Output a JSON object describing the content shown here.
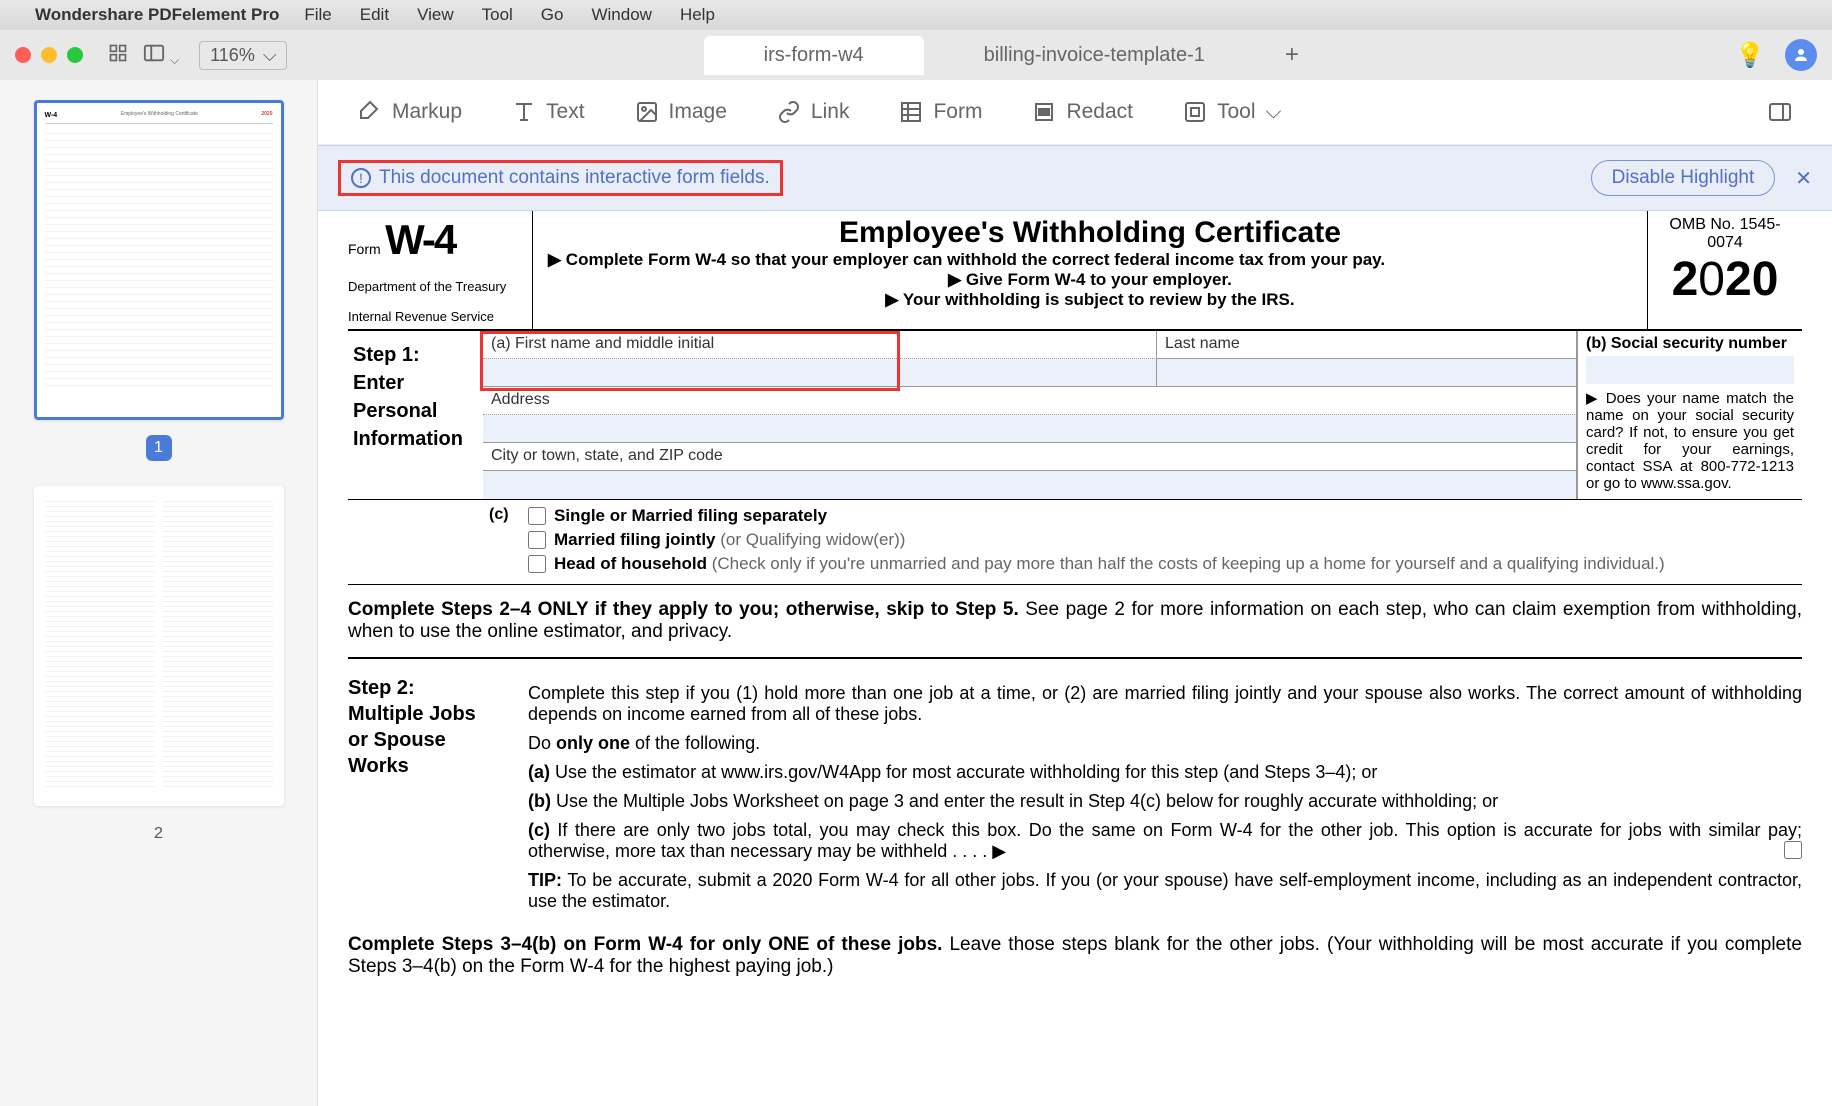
{
  "menubar": {
    "app": "Wondershare PDFelement Pro",
    "items": [
      "File",
      "Edit",
      "View",
      "Tool",
      "Go",
      "Window",
      "Help"
    ]
  },
  "titlebar": {
    "zoom": "116%",
    "tabs": [
      {
        "label": "irs-form-w4",
        "active": true
      },
      {
        "label": "billing-invoice-template-1",
        "active": false
      }
    ]
  },
  "toolbar": {
    "markup": "Markup",
    "text": "Text",
    "image": "Image",
    "link": "Link",
    "form": "Form",
    "redact": "Redact",
    "tool": "Tool"
  },
  "infobar": {
    "message": "This document contains interactive form fields.",
    "disable": "Disable Highlight"
  },
  "thumbnails": {
    "page1": "1",
    "page2": "2"
  },
  "form": {
    "form_prefix": "Form",
    "form_code": "W-4",
    "dept1": "Department of the Treasury",
    "dept2": "Internal Revenue Service",
    "title": "Employee's Withholding Certificate",
    "bullet1": "▶ Complete Form W-4 so that your employer can withhold the correct federal income tax from your pay.",
    "bullet2": "▶ Give Form W-4 to your employer.",
    "bullet3": "▶ Your withholding is subject to review by the IRS.",
    "omb": "OMB No. 1545-0074",
    "year": "2020",
    "step1_label": "Step 1: Enter Personal Information",
    "field_a": "(a)  First name and middle initial",
    "field_lastname": "Last name",
    "field_b": "(b)  Social security number",
    "field_address": "Address",
    "field_city": "City or town, state, and ZIP code",
    "name_match": "▶ Does your name match the name on your social security card? If not, to ensure you get credit for your earnings, contact SSA at 800-772-1213 or go to www.ssa.gov.",
    "filing_c": "(c)",
    "filing1": "Single or Married filing separately",
    "filing2a": "Married filing jointly ",
    "filing2b": "(or Qualifying widow(er))",
    "filing3a": "Head of household ",
    "filing3b": "(Check only if you're unmarried and pay more than half the costs of keeping up a home for yourself and a qualifying individual.)",
    "complete24_bold": "Complete Steps 2–4 ONLY if they apply to you; otherwise, skip to Step 5.",
    "complete24_rest": " See page 2 for more information on each step, who can claim exemption from withholding, when to use the online estimator, and privacy.",
    "step2_label": "Step 2: Multiple Jobs or Spouse Works",
    "step2_intro": "Complete this step if you (1) hold more than one job at a time, or (2) are married filing jointly and your spouse also works. The correct amount of withholding depends on income earned from all of these jobs.",
    "step2_doone": "Do only one of the following.",
    "step2_a": " Use the estimator at www.irs.gov/W4App for most accurate withholding for this step (and Steps 3–4); or",
    "step2_b": " Use the Multiple Jobs Worksheet on page 3 and enter the result in Step 4(c) below for roughly accurate withholding; or",
    "step2_c": " If there are only two jobs total, you may check this box. Do the same on Form W-4 for the other job. This option is accurate for jobs with similar pay; otherwise, more tax than necessary may be withheld  .   .   .   .  ▶",
    "step2_tip_label": "TIP:",
    "step2_tip": " To be accurate, submit a 2020 Form W-4 for all other jobs. If you (or your spouse) have self-employment income, including as an independent contractor, use the estimator.",
    "complete34_bold": "Complete Steps 3–4(b) on Form W-4 for only ONE of these jobs.",
    "complete34_rest": " Leave those steps blank for the other jobs. (Your withholding will be most accurate if you complete Steps 3–4(b) on the Form W-4 for the highest paying job.)"
  }
}
